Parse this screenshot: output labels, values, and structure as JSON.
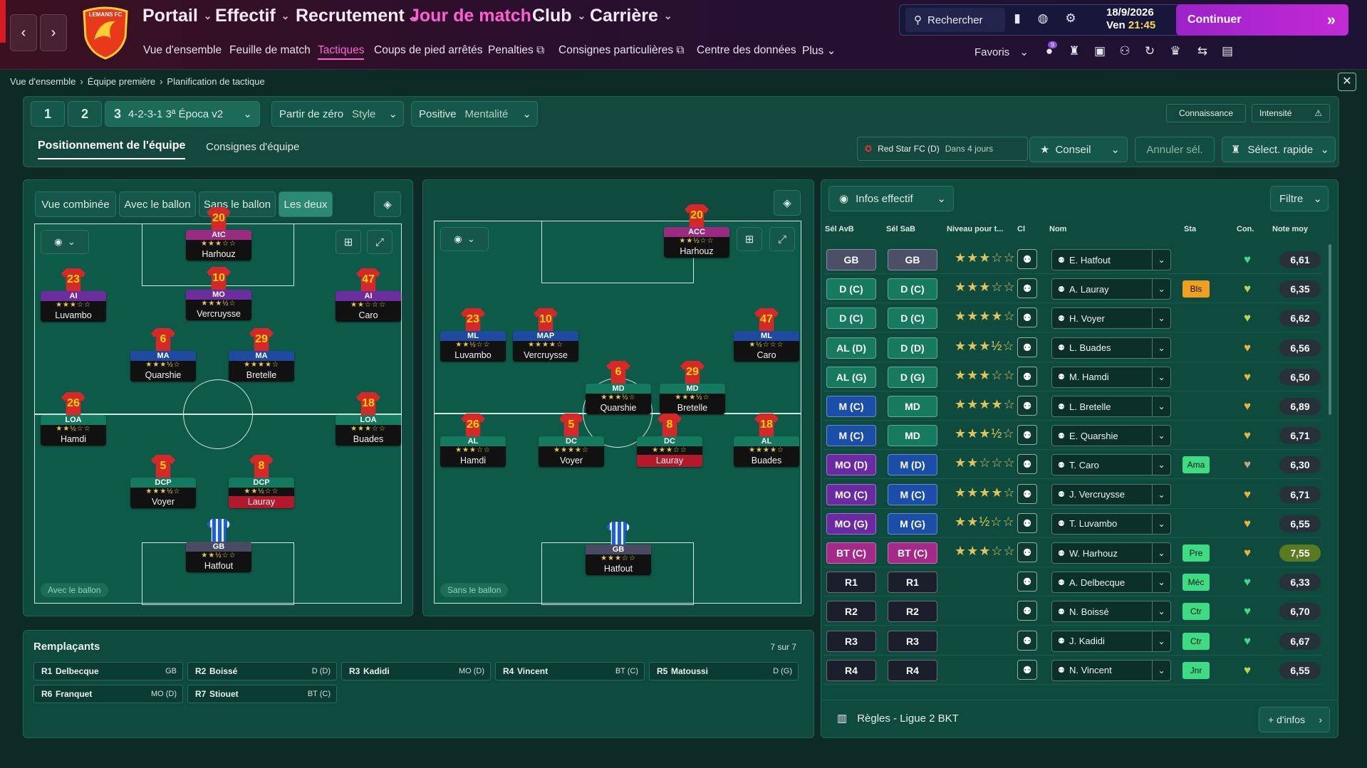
{
  "topbar": {
    "menus": [
      {
        "label": "Portail"
      },
      {
        "label": "Effectif"
      },
      {
        "label": "Recrutement"
      },
      {
        "label": "Jour de match"
      },
      {
        "label": "Club"
      },
      {
        "label": "Carrière"
      }
    ],
    "submenus": [
      "Vue d'ensemble",
      "Feuille de match",
      "Tactiques",
      "Coups de pied arrêtés",
      "Penalties",
      "Consignes particulières",
      "Centre des données",
      "Plus"
    ],
    "logo_text": "LEMANS FC",
    "search": "Rechercher",
    "date": "18/9/2026",
    "day_time": "Ven",
    "time": "21:45",
    "continue": "Continuer",
    "favoris": "Favoris",
    "badge": "9"
  },
  "breadcrumb": [
    "Vue d'ensemble",
    "Équipe première",
    "Planification de tactique"
  ],
  "tactic": {
    "slot1": "1",
    "slot2": "2",
    "slot3": "3",
    "formation": "4-2-3-1 3ª Época v2",
    "style_value": "Partir de zéro",
    "style_label": "Style",
    "mentality_value": "Positive",
    "mentality_label": "Mentalité",
    "knowledge": "Connaissance",
    "intensity": "Intensité",
    "tab_positioning": "Positionnement de l'équipe",
    "tab_instructions": "Consignes d'équipe",
    "opponent": "Red Star FC (D)",
    "opponent_when": "Dans 4 jours",
    "advice": "Conseil",
    "cancel_sel": "Annuler sél.",
    "quick_select": "Sélect. rapide"
  },
  "views": [
    "Vue combinée",
    "Avec le ballon",
    "Sans le ballon",
    "Les deux"
  ],
  "pitch_left": {
    "label": "Avec le ballon",
    "players": [
      {
        "num": "20",
        "role": "AtC",
        "stars": "★★★☆☆",
        "name": "Harhouz",
        "cls": "r-att"
      },
      {
        "num": "23",
        "role": "AI",
        "stars": "★★★☆☆",
        "name": "Luvambo",
        "cls": "r-am"
      },
      {
        "num": "10",
        "role": "MO",
        "stars": "★★★½☆",
        "name": "Vercruysse",
        "cls": "r-am"
      },
      {
        "num": "47",
        "role": "AI",
        "stars": "★★☆☆☆",
        "name": "Caro",
        "cls": "r-am"
      },
      {
        "num": "6",
        "role": "MA",
        "stars": "★★★½☆",
        "name": "Quarshie",
        "cls": "r-mid"
      },
      {
        "num": "29",
        "role": "MA",
        "stars": "★★★★☆",
        "name": "Bretelle",
        "cls": "r-mid"
      },
      {
        "num": "26",
        "role": "LOA",
        "stars": "★★½☆☆",
        "name": "Hamdi",
        "cls": "r-def"
      },
      {
        "num": "18",
        "role": "LOA",
        "stars": "★★★☆☆",
        "name": "Buades",
        "cls": "r-def"
      },
      {
        "num": "5",
        "role": "DCP",
        "stars": "★★★½☆",
        "name": "Voyer",
        "cls": "r-def"
      },
      {
        "num": "8",
        "role": "DCP",
        "stars": "★★½☆☆",
        "name": "Lauray",
        "cls": "r-def"
      },
      {
        "num": "",
        "role": "GB",
        "stars": "★★½☆☆",
        "name": "Hatfout",
        "cls": "r-gk"
      }
    ]
  },
  "pitch_right": {
    "label": "Sans le ballon",
    "players": [
      {
        "num": "20",
        "role": "ACC",
        "stars": "★★½☆☆",
        "name": "Harhouz",
        "cls": "r-att"
      },
      {
        "num": "23",
        "role": "ML",
        "stars": "★★½☆☆",
        "name": "Luvambo",
        "cls": "r-mid"
      },
      {
        "num": "10",
        "role": "MAP",
        "stars": "★★★★☆",
        "name": "Vercruysse",
        "cls": "r-mid"
      },
      {
        "num": "47",
        "role": "ML",
        "stars": "★½☆☆☆",
        "name": "Caro",
        "cls": "r-mid"
      },
      {
        "num": "6",
        "role": "MD",
        "stars": "★★★½☆",
        "name": "Quarshie",
        "cls": "r-def"
      },
      {
        "num": "29",
        "role": "MD",
        "stars": "★★★½☆",
        "name": "Bretelle",
        "cls": "r-def"
      },
      {
        "num": "26",
        "role": "AL",
        "stars": "★★★☆☆",
        "name": "Hamdi",
        "cls": "r-def"
      },
      {
        "num": "5",
        "role": "DC",
        "stars": "★★★★☆",
        "name": "Voyer",
        "cls": "r-def"
      },
      {
        "num": "8",
        "role": "DC",
        "stars": "★★★☆☆",
        "name": "Lauray",
        "cls": "r-def"
      },
      {
        "num": "18",
        "role": "AL",
        "stars": "★★★★☆",
        "name": "Buades",
        "cls": "r-def"
      },
      {
        "num": "",
        "role": "GB",
        "stars": "★★★☆☆",
        "name": "Hatfout",
        "cls": "r-gk"
      }
    ]
  },
  "side": {
    "info_btn": "Infos effectif",
    "filter": "Filtre",
    "headers": [
      "Sél AvB",
      "Sél SaB",
      "Niveau pour t...",
      "Cl",
      "Nom",
      "Sta",
      "Con.",
      "Note moy"
    ],
    "rows": [
      {
        "a": "GB",
        "b": "GB",
        "ca": "p-gk",
        "cb": "p-gk",
        "stars": "★★★☆☆",
        "name": "E. Hatfout",
        "sta": "",
        "sc": "",
        "heart": "#3ddc84",
        "note": "6,61"
      },
      {
        "a": "D (C)",
        "b": "D (C)",
        "ca": "p-def",
        "cb": "p-def",
        "stars": "★★★☆☆",
        "name": "A. Lauray",
        "sta": "Bls",
        "sc": "#f0a020",
        "heart": "#b8d84a",
        "note": "6,35"
      },
      {
        "a": "D (C)",
        "b": "D (C)",
        "ca": "p-def",
        "cb": "p-def",
        "stars": "★★★★☆",
        "name": "H. Voyer",
        "sta": "",
        "sc": "",
        "heart": "#b8d84a",
        "note": "6,62"
      },
      {
        "a": "AL (D)",
        "b": "D (D)",
        "ca": "p-def",
        "cb": "p-def",
        "stars": "★★★½☆",
        "name": "L. Buades",
        "sta": "",
        "sc": "",
        "heart": "#e6b43c",
        "note": "6,56"
      },
      {
        "a": "AL (G)",
        "b": "D (G)",
        "ca": "p-def",
        "cb": "p-def",
        "stars": "★★★☆☆",
        "name": "M. Hamdi",
        "sta": "",
        "sc": "",
        "heart": "#e6b43c",
        "note": "6,50"
      },
      {
        "a": "M (C)",
        "b": "MD",
        "ca": "p-mid",
        "cb": "p-def",
        "stars": "★★★★☆",
        "name": "L. Bretelle",
        "sta": "",
        "sc": "",
        "heart": "#e6b43c",
        "note": "6,89"
      },
      {
        "a": "M (C)",
        "b": "MD",
        "ca": "p-mid",
        "cb": "p-def",
        "stars": "★★★½☆",
        "name": "E. Quarshie",
        "sta": "",
        "sc": "",
        "heart": "#e6b43c",
        "note": "6,71"
      },
      {
        "a": "MO (D)",
        "b": "M (D)",
        "ca": "p-am",
        "cb": "p-mid",
        "stars": "★★☆☆☆",
        "name": "T. Caro",
        "sta": "Ama",
        "sc": "#3ddc84",
        "heart": "#c8a080",
        "note": "6,30"
      },
      {
        "a": "MO (C)",
        "b": "M (C)",
        "ca": "p-am",
        "cb": "p-mid",
        "stars": "★★★★☆",
        "name": "J. Vercruysse",
        "sta": "",
        "sc": "",
        "heart": "#e6b43c",
        "note": "6,71"
      },
      {
        "a": "MO (G)",
        "b": "M (G)",
        "ca": "p-am",
        "cb": "p-mid",
        "stars": "★★½☆☆",
        "name": "T. Luvambo",
        "sta": "",
        "sc": "",
        "heart": "#e6b43c",
        "note": "6,55"
      },
      {
        "a": "BT (C)",
        "b": "BT (C)",
        "ca": "p-att",
        "cb": "p-att",
        "stars": "★★★☆☆",
        "name": "W. Harhouz",
        "sta": "Pre",
        "sc": "#3ddc84",
        "heart": "#e6b43c",
        "note": "7,55"
      },
      {
        "a": "R1",
        "b": "R1",
        "ca": "p-sub",
        "cb": "p-sub",
        "stars": "",
        "name": "A. Delbecque",
        "sta": "Méc",
        "sc": "#3ddc84",
        "heart": "#3ddc84",
        "note": "6,33"
      },
      {
        "a": "R2",
        "b": "R2",
        "ca": "p-sub",
        "cb": "p-sub",
        "stars": "",
        "name": "N. Boissé",
        "sta": "Ctr",
        "sc": "#3ddc84",
        "heart": "#3ddc84",
        "note": "6,70"
      },
      {
        "a": "R3",
        "b": "R3",
        "ca": "p-sub",
        "cb": "p-sub",
        "stars": "",
        "name": "J. Kadidi",
        "sta": "Ctr",
        "sc": "#3ddc84",
        "heart": "#3ddc84",
        "note": "6,67"
      },
      {
        "a": "R4",
        "b": "R4",
        "ca": "p-sub",
        "cb": "p-sub",
        "stars": "",
        "name": "N. Vincent",
        "sta": "Jnr",
        "sc": "#3ddc84",
        "heart": "#b8d84a",
        "note": "6,55"
      }
    ],
    "rules": "Règles - Ligue 2 BKT",
    "more_info": "+ d'infos"
  },
  "subs": {
    "title": "Remplaçants",
    "count": "7 sur 7",
    "items": [
      {
        "r": "R1",
        "name": "Delbecque",
        "pos": "GB"
      },
      {
        "r": "R2",
        "name": "Boissé",
        "pos": "D (D)"
      },
      {
        "r": "R3",
        "name": "Kadidi",
        "pos": "MO (D)"
      },
      {
        "r": "R4",
        "name": "Vincent",
        "pos": "BT (C)"
      },
      {
        "r": "R5",
        "name": "Matoussi",
        "pos": "D (G)"
      },
      {
        "r": "R6",
        "name": "Franquet",
        "pos": "MO (D)"
      },
      {
        "r": "R7",
        "name": "Stiouet",
        "pos": "BT (C)"
      }
    ]
  }
}
